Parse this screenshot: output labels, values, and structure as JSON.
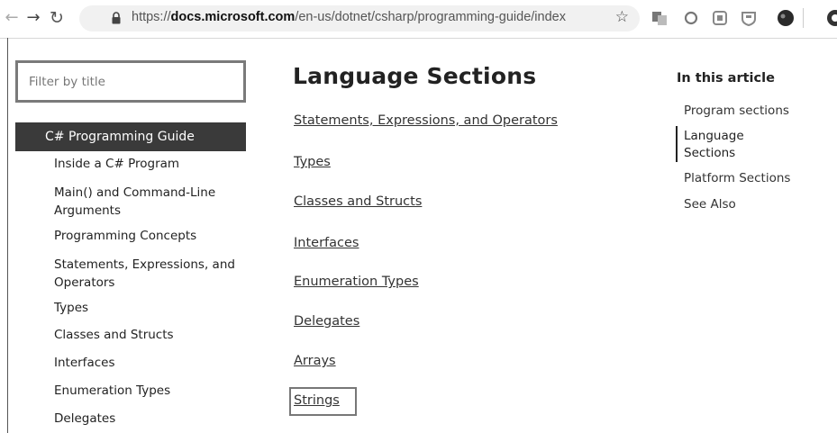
{
  "browser": {
    "url_prefix": "https://",
    "url_domain": "docs.microsoft.com",
    "url_path": "/en-us/dotnet/csharp/programming-guide/index"
  },
  "sidebar": {
    "filter_placeholder": "Filter by title",
    "active_item": "C# Programming Guide",
    "items": [
      "Inside a C# Program",
      "Main() and Command-Line Arguments",
      "Programming Concepts",
      "Statements, Expressions, and Operators",
      "Types",
      "Classes and Structs",
      "Interfaces",
      "Enumeration Types",
      "Delegates"
    ]
  },
  "main": {
    "title": "Language Sections",
    "links": [
      "Statements, Expressions, and Operators",
      "Types",
      "Classes and Structs",
      "Interfaces",
      "Enumeration Types",
      "Delegates",
      "Arrays",
      "Strings"
    ]
  },
  "in_this_article": {
    "title": "In this article",
    "links": [
      "Program sections",
      "Language Sections",
      "Platform Sections",
      "See Also"
    ],
    "active": "Language Sections"
  }
}
